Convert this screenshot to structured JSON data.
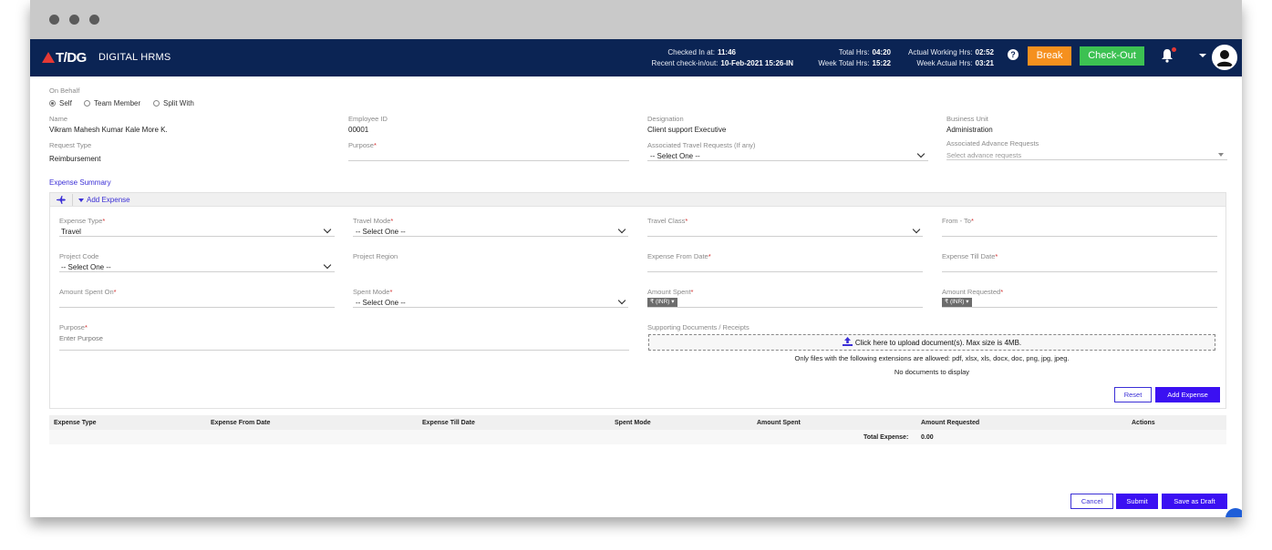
{
  "header": {
    "logo_text": "T/DG",
    "app_name": "DIGITAL HRMS",
    "checked_in_label": "Checked In at:",
    "checked_in_value": "11:46",
    "recent_label": "Recent check-in/out:",
    "recent_value": "10-Feb-2021 15:26-IN",
    "total_hrs_label": "Total Hrs:",
    "total_hrs_value": "04:20",
    "week_total_label": "Week Total Hrs:",
    "week_total_value": "15:22",
    "actual_working_label": "Actual Working Hrs:",
    "actual_working_value": "02:52",
    "week_actual_label": "Week Actual Hrs:",
    "week_actual_value": "03:21",
    "help_icon": "?",
    "break_label": "Break",
    "checkout_label": "Check-Out",
    "colors": {
      "bar": "#0b2454",
      "break": "#f5901e",
      "checkout": "#3cc152"
    }
  },
  "on_behalf": {
    "label": "On Behalf",
    "options": [
      "Self",
      "Team Member",
      "Split With"
    ],
    "selected": "Self"
  },
  "employee": {
    "name_label": "Name",
    "name_value": "Vikram Mahesh Kumar Kale More K.",
    "id_label": "Employee ID",
    "id_value": "00001",
    "designation_label": "Designation",
    "designation_value": "Client support Executive",
    "bu_label": "Business Unit",
    "bu_value": "Administration",
    "request_type_label": "Request Type",
    "request_type_value": "Reimbursement",
    "purpose_label": "Purpose",
    "travel_req_label": "Associated Travel Requests (If any)",
    "travel_req_value": "-- Select One --",
    "advance_label": "Associated Advance Requests",
    "advance_placeholder": "Select advance requests"
  },
  "expense": {
    "summary_title": "Expense Summary",
    "add_expense_toggle": "Add Expense",
    "expense_type_label": "Expense Type",
    "expense_type_value": "Travel",
    "travel_mode_label": "Travel Mode",
    "travel_mode_value": "-- Select One --",
    "travel_class_label": "Travel Class",
    "from_to_label": "From - To",
    "project_code_label": "Project Code",
    "project_code_value": "-- Select One --",
    "project_region_label": "Project Region",
    "from_date_label": "Expense From Date",
    "till_date_label": "Expense Till Date",
    "amount_spent_on_label": "Amount Spent On",
    "spent_mode_label": "Spent Mode",
    "spent_mode_value": "-- Select One --",
    "amount_spent_label": "Amount Spent",
    "amount_requested_label": "Amount Requested",
    "currency": "₹ (INR)",
    "purpose_label": "Purpose",
    "purpose_placeholder": "Enter Purpose",
    "docs_label": "Supporting Documents / Receipts",
    "upload_text": "Click here to upload document(s). Max size is 4MB.",
    "extensions_note": "Only files with the following extensions are allowed: pdf, xlsx, xls, docx, doc, png, jpg, jpeg.",
    "no_docs": "No documents to display",
    "reset_label": "Reset",
    "add_label": "Add Expense"
  },
  "table": {
    "columns": [
      "Expense Type",
      "Expense From Date",
      "Expense Till Date",
      "Spent Mode",
      "Amount Spent",
      "Amount Requested",
      "Actions"
    ],
    "total_label": "Total Expense:",
    "total_value": "0.00"
  },
  "footer": {
    "cancel_label": "Cancel",
    "submit_label": "Submit",
    "draft_label": "Save as Draft"
  }
}
